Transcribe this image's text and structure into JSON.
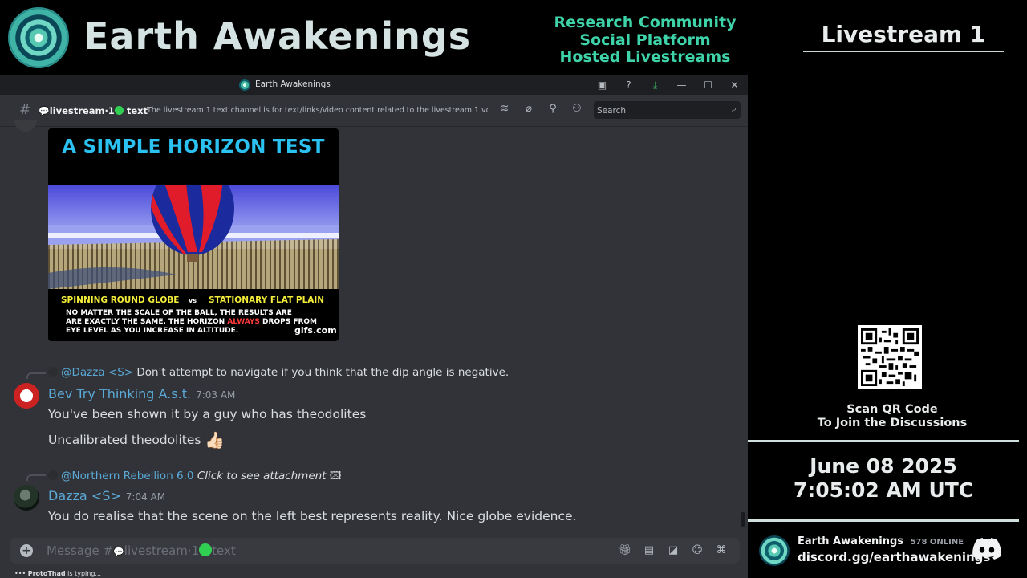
{
  "banner": {
    "brand": "Earth Awakenings",
    "taglines": [
      "Research Community",
      "Social Platform",
      "Hosted Livestreams"
    ]
  },
  "right_panel": {
    "title": "Livestream 1",
    "qr_caption": [
      "Scan QR Code",
      "To Join the Discussions"
    ],
    "date": "June 08 2025",
    "time": "7:05:02 AM UTC",
    "server_name": "Earth Awakenings",
    "online": "578 ONLINE",
    "invite": "discord.gg/earthawakenings"
  },
  "window": {
    "title": "Earth Awakenings",
    "titlebar_icons": [
      "screen-share-icon",
      "help-icon",
      "download-icon",
      "minimize-icon",
      "maximize-icon",
      "close-icon"
    ]
  },
  "channel": {
    "hash": "#",
    "name_prefix": "livestream·1",
    "name_suffix": "text",
    "topic": "The livestream 1 text channel is for text/links/video content related to the livestream 1 voic...",
    "search_placeholder": "Search"
  },
  "gif": {
    "title": "A SIMPLE HORIZON TEST",
    "left_label": "SPINNING ROUND GLOBE",
    "vs": "vs",
    "right_label": "STATIONARY FLAT PLAIN",
    "note_1": "NO MATTER THE SCALE OF THE BALL, THE RESULTS ARE",
    "note_2a": "ARE EXACTLY THE SAME. THE HORIZON ",
    "note_2b": "ALWAYS",
    "note_2c": " DROPS FROM",
    "note_3": "EYE LEVEL AS YOU INCREASE IN ALTITUDE.",
    "source": "gifs.com"
  },
  "messages": [
    {
      "reply_to": "@Dazza <S>",
      "reply_text": "Don't attempt to navigate if you think that the dip angle is negative.",
      "author": "Bev Try Thinking A.s.t.",
      "time": "7:03 AM",
      "lines": [
        "You've been shown it by a guy who has theodolites",
        "Uncalibrated theodolites"
      ],
      "emoji": "👍🏻"
    },
    {
      "reply_to": "@Northern Rebellion 6.0",
      "reply_text": "Click to see attachment",
      "author": "Dazza <S>",
      "time": "7:04 AM",
      "lines": [
        "You do realise that the scene on the left best represents reality. Nice globe evidence."
      ]
    }
  ],
  "composer": {
    "placeholder_prefix": "Message #",
    "placeholder_channel": "livestream·1",
    "placeholder_suffix": "text",
    "typing_user": "ProtoThad",
    "typing_text": "is typing..."
  },
  "colors": {
    "accent_teal": "#3fd3a9",
    "username_blue": "#5ba9d6",
    "discord_bg": "#313338"
  }
}
